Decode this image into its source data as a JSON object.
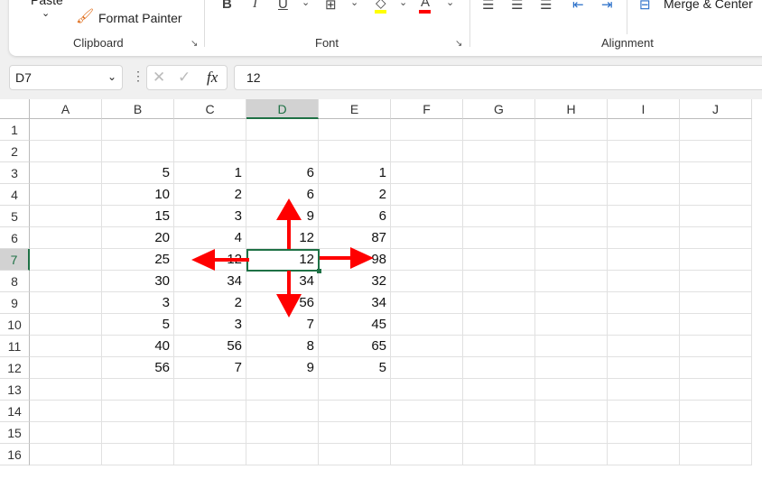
{
  "ribbon": {
    "paste": "Paste",
    "format_painter": "Format Painter",
    "clipboard": "Clipboard",
    "font": "Font",
    "alignment": "Alignment",
    "merge_center": "Merge & Center",
    "bold": "B",
    "italic": "I",
    "underline": "U",
    "font_color": "A",
    "colors": {
      "highlight": "#ffff00",
      "font": "#ff0000"
    }
  },
  "formula_bar": {
    "name_box": "D7",
    "fx": "fx",
    "value": "12"
  },
  "columns": [
    "A",
    "B",
    "C",
    "D",
    "E",
    "F",
    "G",
    "H",
    "I",
    "J"
  ],
  "rows": [
    "1",
    "2",
    "3",
    "4",
    "5",
    "6",
    "7",
    "8",
    "9",
    "10",
    "11",
    "12",
    "13",
    "14",
    "15",
    "16"
  ],
  "selected": {
    "col": "D",
    "row": "7"
  },
  "data": [
    [
      "5",
      "1",
      "6",
      "1"
    ],
    [
      "10",
      "2",
      "6",
      "2"
    ],
    [
      "15",
      "3",
      "9",
      "6"
    ],
    [
      "20",
      "4",
      "12",
      "87"
    ],
    [
      "25",
      "12",
      "12",
      "98"
    ],
    [
      "30",
      "34",
      "34",
      "32"
    ],
    [
      "3",
      "2",
      "56",
      "34"
    ],
    [
      "5",
      "3",
      "7",
      "45"
    ],
    [
      "40",
      "56",
      "8",
      "65"
    ],
    [
      "56",
      "7",
      "9",
      "5"
    ]
  ],
  "arrow_color": "#ff0000"
}
